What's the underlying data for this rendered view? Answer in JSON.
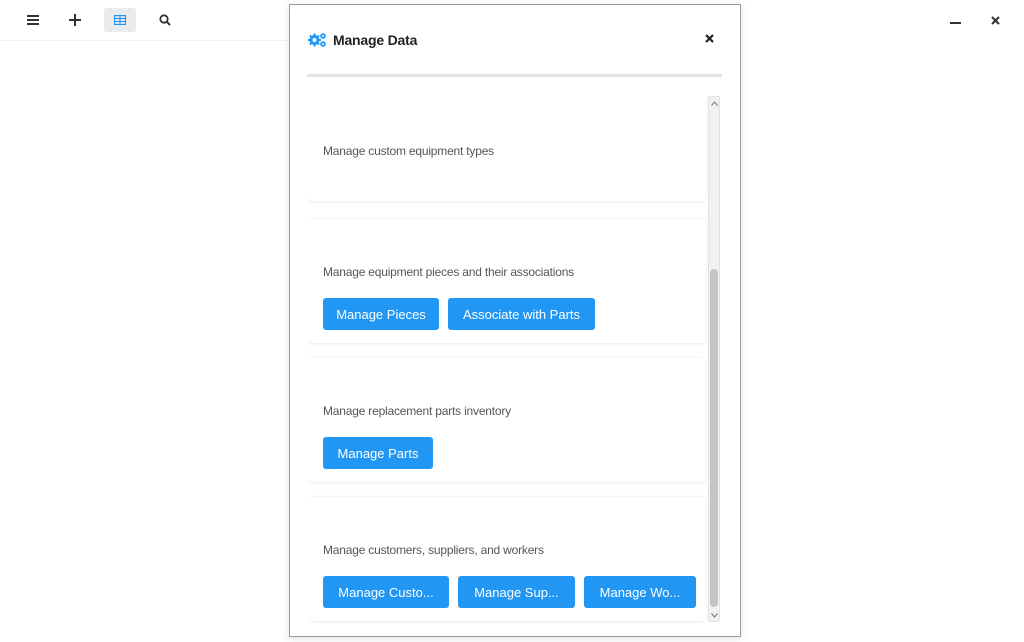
{
  "toolbar": {
    "menu_icon": "hamburger-icon",
    "add_icon": "plus-icon",
    "table_icon": "table-icon",
    "search_icon": "search-icon"
  },
  "window_controls": {
    "minimize_icon": "minimize-icon",
    "close_icon": "close-icon"
  },
  "dialog": {
    "title": "Manage Data",
    "title_icon": "cogs-icon",
    "close_icon": "close-icon",
    "sections": [
      {
        "description": "Manage custom equipment types",
        "buttons": []
      },
      {
        "description": "Manage equipment pieces and their associations",
        "buttons": [
          "Manage Pieces",
          "Associate with Parts"
        ]
      },
      {
        "description": "Manage replacement parts inventory",
        "buttons": [
          "Manage Parts"
        ]
      },
      {
        "description": "Manage customers, suppliers, and workers",
        "buttons": [
          "Manage Custo...",
          "Manage Sup...",
          "Manage Wo..."
        ]
      }
    ]
  },
  "colors": {
    "accent": "#2196f3",
    "button_text": "#ffffff",
    "scrollbar_thumb": "#c4c4c4"
  }
}
